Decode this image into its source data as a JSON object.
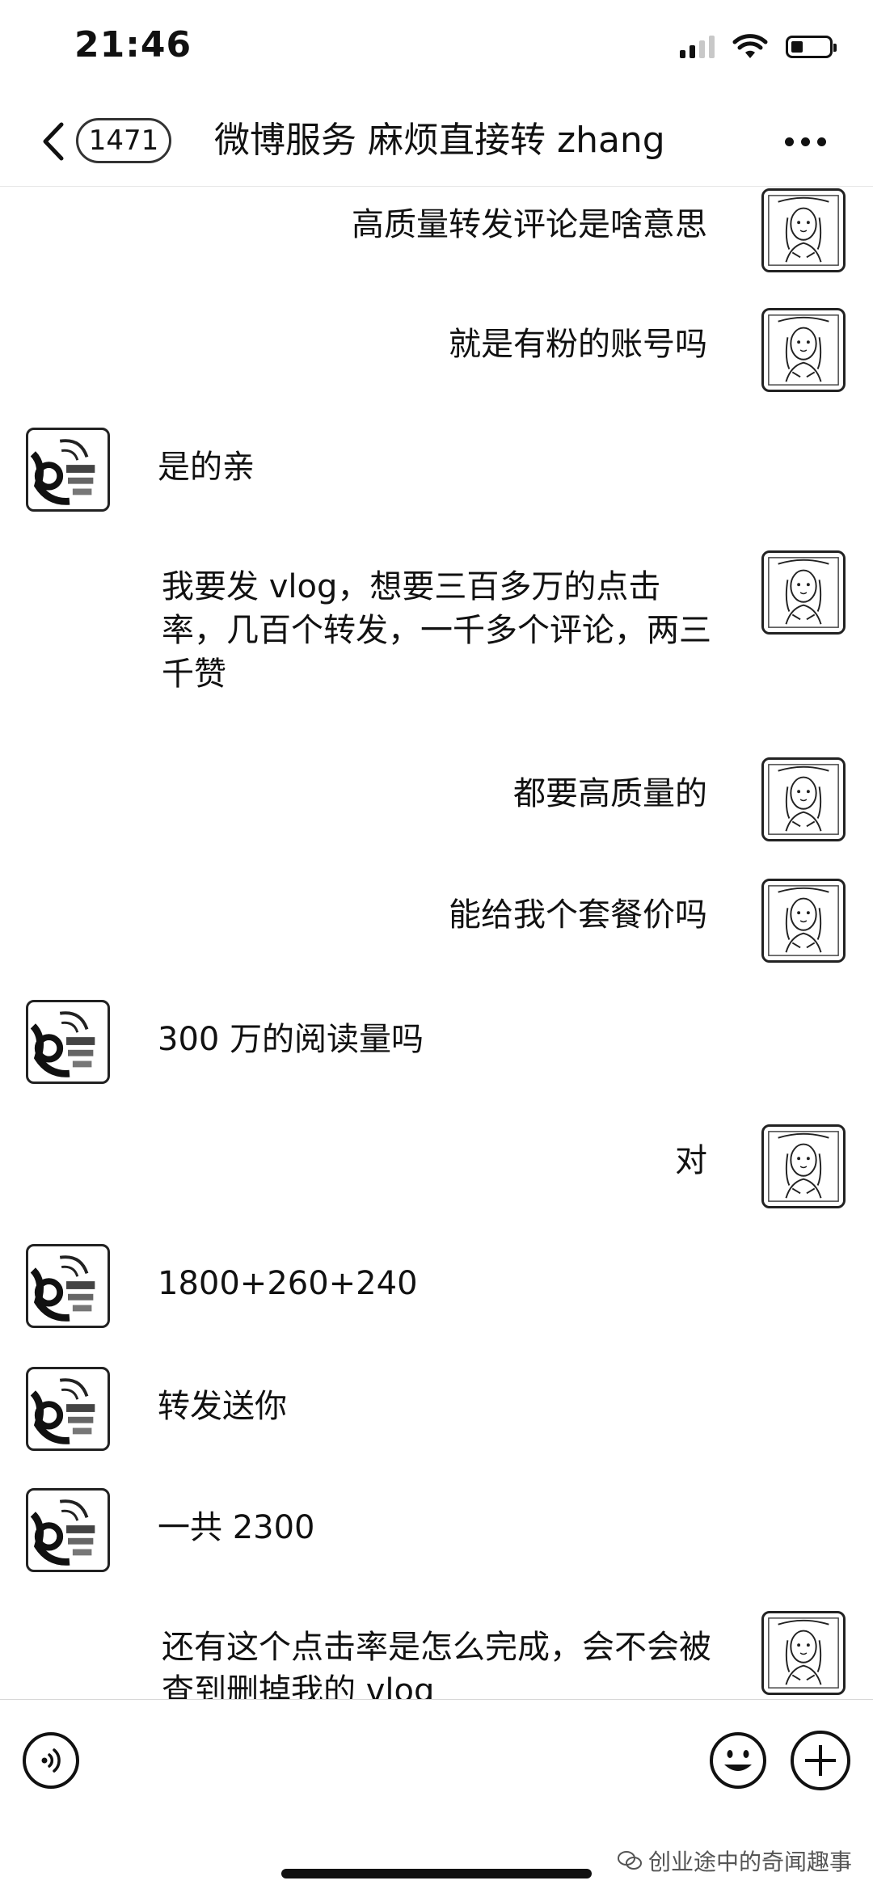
{
  "status_bar": {
    "time": "21:46"
  },
  "nav": {
    "unread_count": "1471",
    "title": "微博服务 麻烦直接转 zhang"
  },
  "messages": [
    {
      "sender": "user",
      "text": "高质量转发评论是啥意思"
    },
    {
      "sender": "user",
      "text": "就是有粉的账号吗"
    },
    {
      "sender": "service",
      "text": "是的亲"
    },
    {
      "sender": "user",
      "text": "我要发 vlog，想要三百多万的点击率，几百个转发，一千多个评论，两三千赞"
    },
    {
      "sender": "user",
      "text": "都要高质量的"
    },
    {
      "sender": "user",
      "text": "能给我个套餐价吗"
    },
    {
      "sender": "service",
      "text": "300 万的阅读量吗"
    },
    {
      "sender": "user",
      "text": "对"
    },
    {
      "sender": "service",
      "text": "1800+260+240"
    },
    {
      "sender": "service",
      "text": "转发送你"
    },
    {
      "sender": "service",
      "text": "一共 2300"
    },
    {
      "sender": "user",
      "text": "还有这个点击率是怎么完成，会不会被查到删掉我的 vlog"
    }
  ],
  "watermark": {
    "text": "创业途中的奇闻趣事"
  },
  "icons": {
    "voice": "voice-icon",
    "emoji": "emoji-icon",
    "add": "plus-icon",
    "back": "chevron-left-icon",
    "more": "more-icon"
  }
}
